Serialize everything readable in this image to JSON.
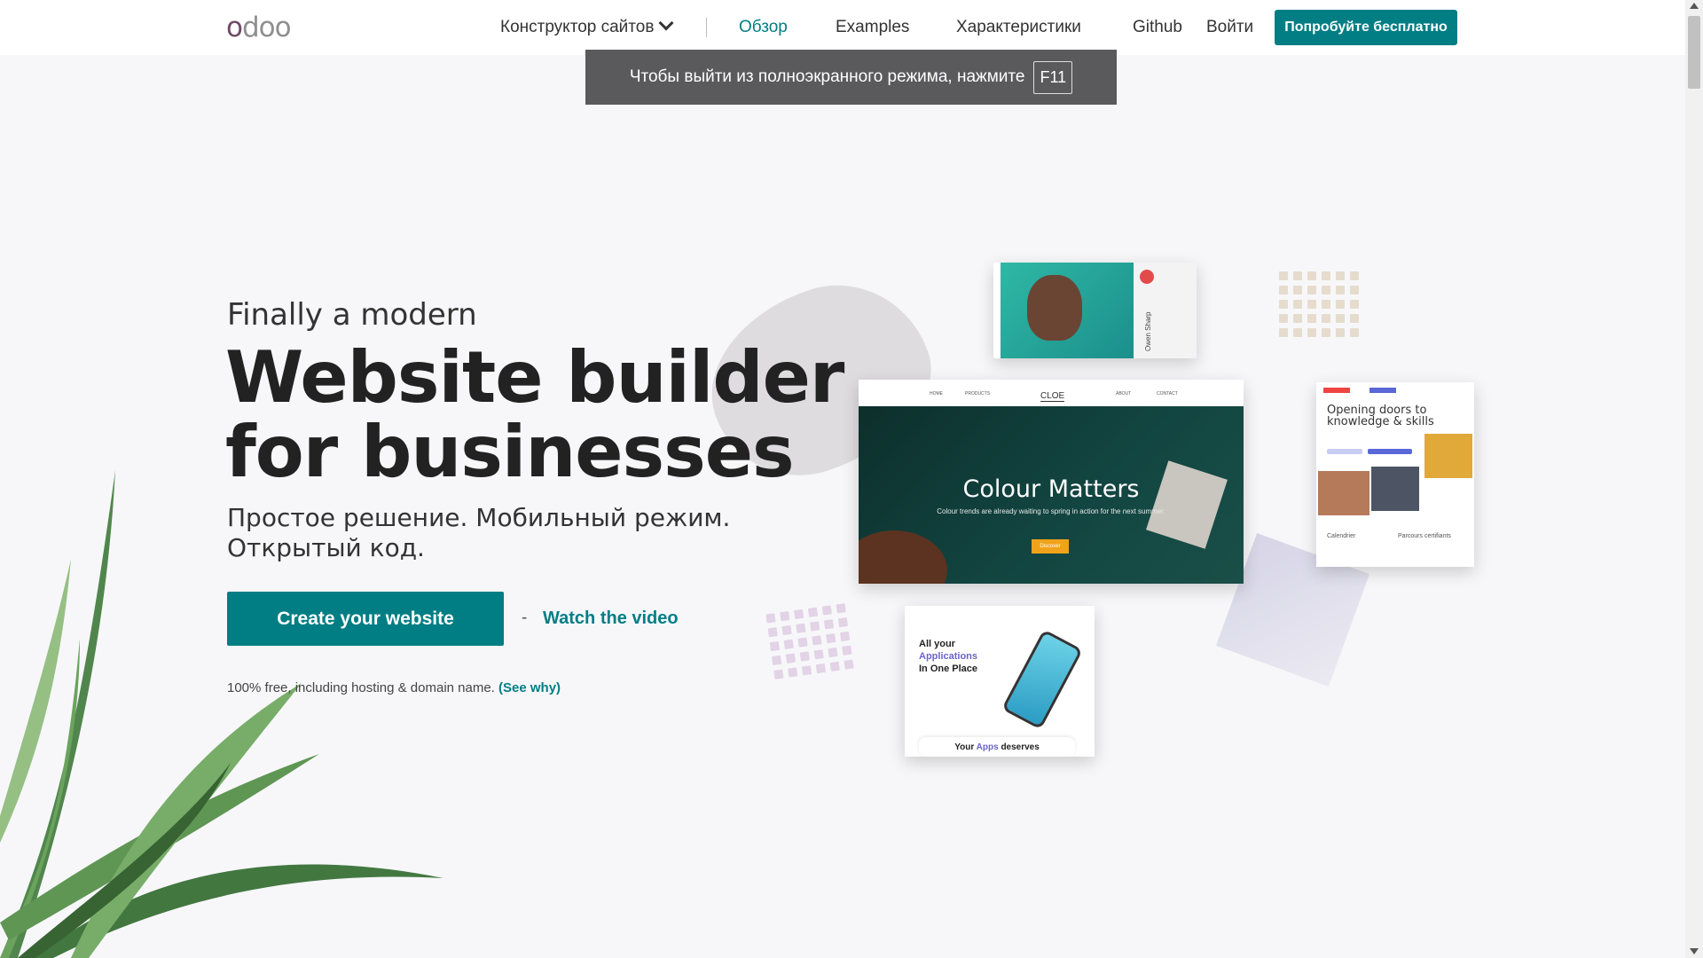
{
  "nav": {
    "logo": "odoo",
    "product_menu": "Конструктор сайтов",
    "items": [
      "Обзор",
      "Examples",
      "Характеристики",
      "Github",
      "Войти"
    ],
    "cta": "Попробуйте бесплатно"
  },
  "fullscreen_toast": {
    "text": "Чтобы выйти из полноэкранного режима, нажмите",
    "key": "F11"
  },
  "hero": {
    "kicker": "Finally a modern",
    "title_line1": "Website builder",
    "title_line2": "for businesses",
    "subtitle": "Простое решение. Мобильный режим. Открытый код.",
    "primary_button": "Create your website",
    "dash": "-",
    "video_link": "Watch the video",
    "note": "100% free, including hosting & domain name.",
    "note_link": "(See why)"
  },
  "mockups": {
    "main": {
      "nav_items": [
        "HOME",
        "PRODUCTS",
        "ABOUT",
        "CONTACT"
      ],
      "logo": "CLOE",
      "title": "Colour Matters",
      "subtitle": "Colour trends are already waiting to spring in action for the next summer.",
      "button": "Discover"
    },
    "profile": {
      "name": "Owen Sharp"
    },
    "education": {
      "title": "Opening doors to knowledge & skills",
      "label_left": "Calendrier",
      "label_right": "Parcours certifiants"
    },
    "apps": {
      "title_line1": "All your",
      "title_line2": "Applications",
      "title_line3": "In One Place",
      "bottom_text_a": "Your",
      "bottom_text_b": "Apps",
      "bottom_text_c": "deserves"
    }
  },
  "colors": {
    "brand": "#017e84",
    "logo_purple": "#714b67",
    "toast_bg": "#5a5a5c",
    "accent_violet": "#6b64c8"
  }
}
